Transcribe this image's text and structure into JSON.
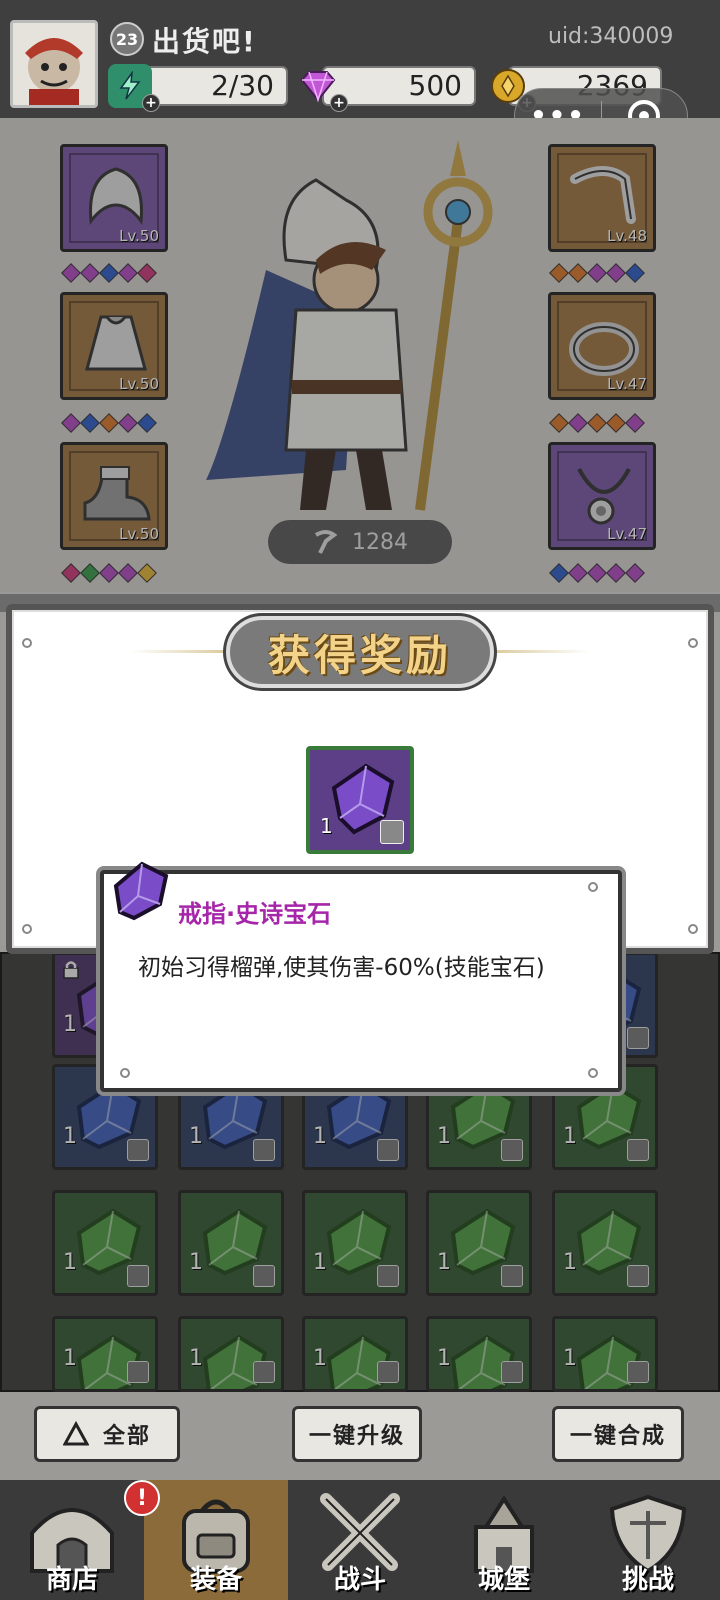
{
  "header": {
    "level": "23",
    "player_name": "出货吧!",
    "uid": "uid:340009",
    "energy": "2/30",
    "gems": "500",
    "coins": "2369",
    "plus": "+"
  },
  "capsule": {
    "dots": "•••"
  },
  "equipment": {
    "left": [
      {
        "level": "Lv.50",
        "gems": [
          "#b04ac0",
          "#b04ac0",
          "#2e5fc7",
          "#b04ac0",
          "#c93a7a"
        ]
      },
      {
        "level": "Lv.50",
        "gems": [
          "#b04ac0",
          "#2e5fc7",
          "#d9762a",
          "#b04ac0",
          "#2e5fc7"
        ]
      },
      {
        "level": "Lv.50",
        "gems": [
          "#c93a7a",
          "#3a9a4a",
          "#b04ac0",
          "#b04ac0",
          "#e0b23a"
        ]
      }
    ],
    "right": [
      {
        "level": "Lv.48",
        "gems": [
          "#d9762a",
          "#d9762a",
          "#b04ac0",
          "#b04ac0",
          "#2e5fc7"
        ]
      },
      {
        "level": "Lv.47",
        "gems": [
          "#d9762a",
          "#b04ac0",
          "#d9762a",
          "#d9762a",
          "#b04ac0"
        ]
      },
      {
        "level": "Lv.47",
        "gems": [
          "#2e5fc7",
          "#b04ac0",
          "#b04ac0",
          "#b04ac0",
          "#b04ac0"
        ]
      }
    ],
    "power": "1284"
  },
  "reward": {
    "title": "获得奖励",
    "item_count": "1"
  },
  "tooltip": {
    "title": "戒指·史诗宝石",
    "description": "初始习得榴弹,使其伤害-60%(技能宝石)"
  },
  "inventory": {
    "count": "1",
    "rows": [
      [
        "purple-locked",
        "hidden",
        "hidden",
        "hidden",
        "blue"
      ],
      [
        "blue",
        "blue",
        "blue",
        "green",
        "green"
      ],
      [
        "green",
        "green",
        "green",
        "green",
        "green"
      ],
      [
        "green",
        "green",
        "green",
        "green",
        "green"
      ]
    ]
  },
  "actions": {
    "filter_label": "全部",
    "upgrade_label": "一键升级",
    "merge_label": "一键合成"
  },
  "nav": {
    "shop": "商店",
    "equip": "装备",
    "battle": "战斗",
    "castle": "城堡",
    "challenge": "挑战",
    "badge": "!"
  }
}
